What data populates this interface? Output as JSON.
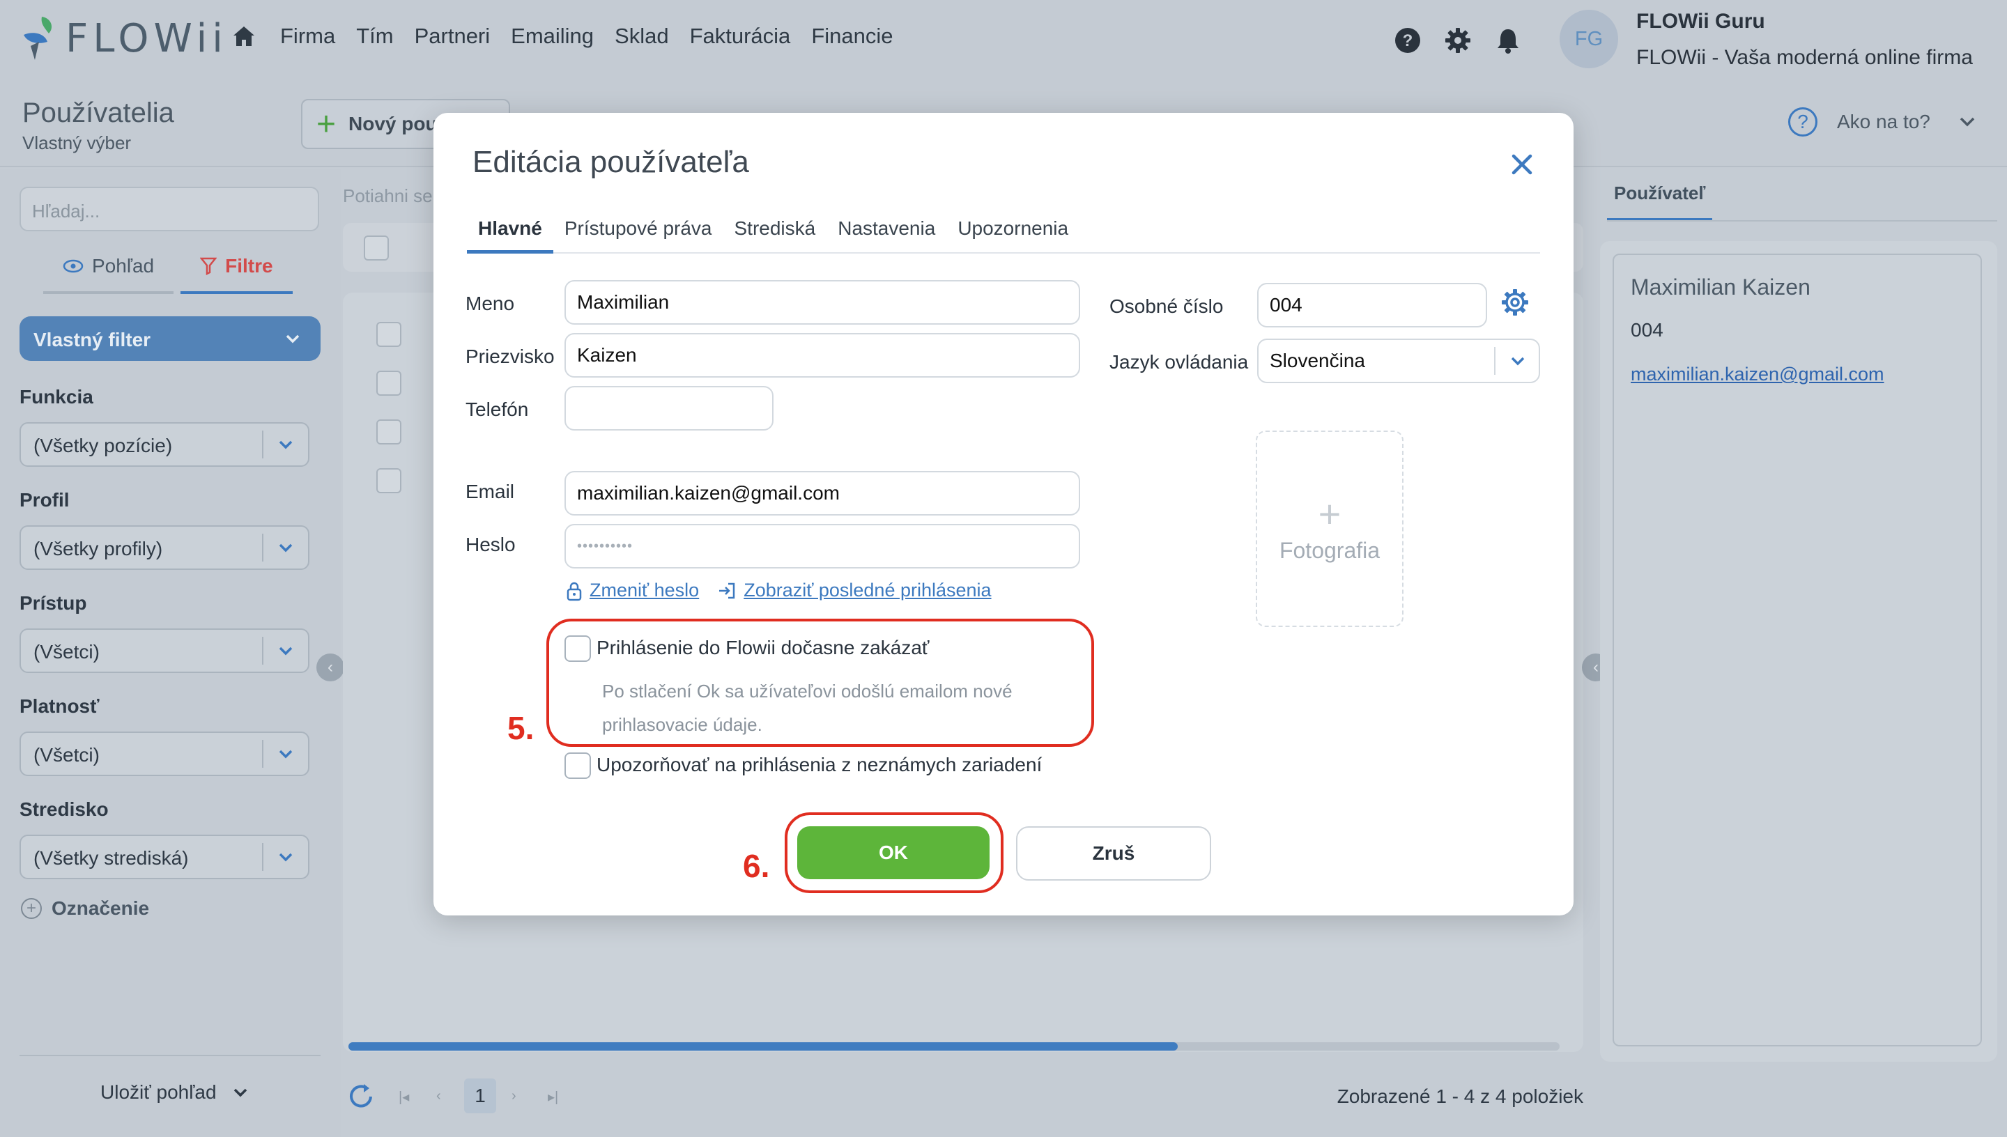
{
  "app": {
    "logo_text": "FLOWii"
  },
  "nav": {
    "items": [
      "Firma",
      "Tím",
      "Partneri",
      "Emailing",
      "Sklad",
      "Fakturácia",
      "Financie"
    ]
  },
  "user": {
    "initials": "FG",
    "name": "FLOWii Guru",
    "company": "FLOWii - Vaša moderná online firma"
  },
  "page": {
    "title": "Používatelia",
    "subtitle": "Vlastný výber",
    "new_button": "Nový pou",
    "help": "Ako na to?"
  },
  "sidebar": {
    "search_placeholder": "Hľadaj...",
    "tabs": [
      "Pohľad",
      "Filtre"
    ],
    "active_filter": "Vlastný filter",
    "filters": [
      {
        "label": "Funkcia",
        "value": "(Všetky pozície)"
      },
      {
        "label": "Profil",
        "value": "(Všetky profily)"
      },
      {
        "label": "Prístup",
        "value": "(Všetci)"
      },
      {
        "label": "Platnosť",
        "value": "(Všetci)"
      },
      {
        "label": "Stredisko",
        "value": "(Všetky strediská)"
      }
    ],
    "add_label": "Označenie",
    "save_view": "Uložiť pohľad"
  },
  "grid": {
    "drag_hint": "Potiahni se",
    "page": "1",
    "info": "Zobrazené 1 - 4 z 4 položiek"
  },
  "right_panel": {
    "tab": "Používateľ",
    "name": "Maximilian Kaizen",
    "number": "004",
    "email": "maximilian.kaizen@gmail.com"
  },
  "modal": {
    "title": "Editácia používateľa",
    "tabs": [
      "Hlavné",
      "Prístupové práva",
      "Strediská",
      "Nastavenia",
      "Upozornenia"
    ],
    "fields": {
      "meno": {
        "label": "Meno",
        "value": "Maximilian"
      },
      "priezvisko": {
        "label": "Priezvisko",
        "value": "Kaizen"
      },
      "telefon": {
        "label": "Telefón",
        "value": ""
      },
      "email": {
        "label": "Email",
        "value": "maximilian.kaizen@gmail.com"
      },
      "heslo": {
        "label": "Heslo",
        "value": "••••••••••"
      },
      "osobne_cislo": {
        "label": "Osobné číslo",
        "value": "004"
      },
      "jazyk": {
        "label": "Jazyk ovládania",
        "value": "Slovenčina"
      }
    },
    "change_password": "Zmeniť heslo",
    "show_last_login": "Zobraziť posledné prihlásenia",
    "photo": "Fotografia",
    "disable_login": "Prihlásenie do Flowii dočasne zakázať",
    "disable_hint": "Po stlačení Ok sa užívateľovi odošlú emailom nové prihlasovacie údaje.",
    "warn_unknown": "Upozorňovať na prihlásenia z neznámych zariadení",
    "ok": "OK",
    "cancel": "Zruš",
    "step5": "5.",
    "step6": "6."
  },
  "colors": {
    "accent": "#3c79bf",
    "ok_green": "#5db53a",
    "highlight_red": "#e02d20",
    "overlay": "#c5ccd4"
  }
}
